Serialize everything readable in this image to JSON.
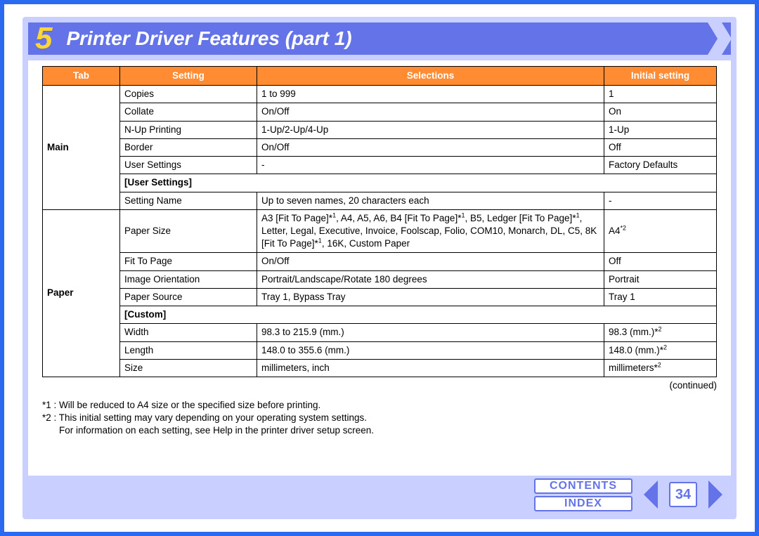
{
  "chapter_number": "5",
  "page_title": "Printer Driver Features (part 1)",
  "columns": {
    "tab": "Tab",
    "setting": "Setting",
    "selections": "Selections",
    "initial": "Initial setting"
  },
  "groups": [
    {
      "tab_label": "Main",
      "rows": [
        {
          "setting": "Copies",
          "selections": "1 to 999",
          "initial": "1"
        },
        {
          "setting": "Collate",
          "selections": "On/Off",
          "initial": "On"
        },
        {
          "setting": "N-Up Printing",
          "selections": "1-Up/2-Up/4-Up",
          "initial": "1-Up"
        },
        {
          "setting": "Border",
          "selections": "On/Off",
          "initial": "Off"
        },
        {
          "setting": "User Settings",
          "selections": "-",
          "initial": "Factory Defaults"
        }
      ],
      "sub_section_label": "[User Settings]",
      "sub_rows": [
        {
          "setting": "Setting Name",
          "selections": "Up to seven names, 20 characters each",
          "initial": "-"
        }
      ]
    },
    {
      "tab_label": "Paper",
      "rows": [
        {
          "setting": "Paper Size",
          "selections_parts": [
            "A3 [Fit To Page]*",
            "1",
            ", A4, A5, A6, B4 [Fit To Page]*",
            "1",
            ", B5, Ledger [Fit To Page]*",
            "1",
            ", Letter, Legal, Executive, Invoice, Foolscap, Folio, COM10, Monarch, DL, C5, 8K [Fit To Page]*",
            "1",
            ", 16K, Custom Paper"
          ],
          "initial_base": "A4",
          "initial_sup": "*2"
        },
        {
          "setting": "Fit To Page",
          "selections": "On/Off",
          "initial": "Off"
        },
        {
          "setting": "Image Orientation",
          "selections": "Portrait/Landscape/Rotate 180 degrees",
          "initial": "Portrait"
        },
        {
          "setting": "Paper Source",
          "selections": "Tray 1, Bypass Tray",
          "initial": "Tray 1"
        }
      ],
      "sub_section_label": "[Custom]",
      "sub_rows": [
        {
          "setting": "Width",
          "selections": "98.3 to 215.9 (mm.)",
          "initial_base": "98.3 (mm.)*",
          "initial_sup": "2"
        },
        {
          "setting": "Length",
          "selections": "148.0 to 355.6 (mm.)",
          "initial_base": "148.0 (mm.)*",
          "initial_sup": "2"
        },
        {
          "setting": "Size",
          "selections": "millimeters, inch",
          "initial_base": "millimeters*",
          "initial_sup": "2"
        }
      ]
    }
  ],
  "continued_label": "(continued)",
  "footnotes": {
    "fn1": "*1 : Will be reduced to A4 size or the specified size before printing.",
    "fn2": "*2 : This initial setting may vary depending on your operating system settings.",
    "extra": "For information on each setting, see Help in the printer driver setup screen."
  },
  "footer": {
    "contents": "CONTENTS",
    "index": "INDEX",
    "page_number": "34"
  },
  "colors": {
    "frame_blue": "#2a6af0",
    "panel_lavender": "#c9cfff",
    "header_purple": "#6474e8",
    "accent_orange": "#ff8c33",
    "number_yellow": "#ffd633"
  }
}
